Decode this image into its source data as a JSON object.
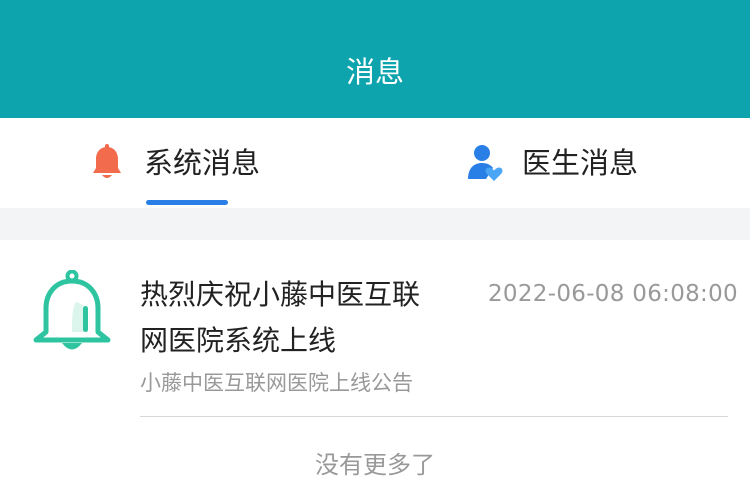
{
  "header": {
    "title": "消息",
    "background_color": "#0ea4ad"
  },
  "tabs": [
    {
      "label": "系统消息",
      "icon": "bell-icon",
      "icon_color": "#f26b4d",
      "active": true
    },
    {
      "label": "医生消息",
      "icon": "doctor-heart-icon",
      "icon_color": "#2a7fe6",
      "active": false
    }
  ],
  "active_tab_indicator_color": "#2a7fe6",
  "messages": [
    {
      "icon": "bell-icon",
      "icon_color": "#2ec4a0",
      "title": "热烈庆祝小藤中医互联\n网医院系统上线",
      "time": "2022-06-08 06:08:00",
      "summary": "小藤中医互联网医院上线公告"
    }
  ],
  "footer": {
    "no_more": "没有更多了"
  }
}
